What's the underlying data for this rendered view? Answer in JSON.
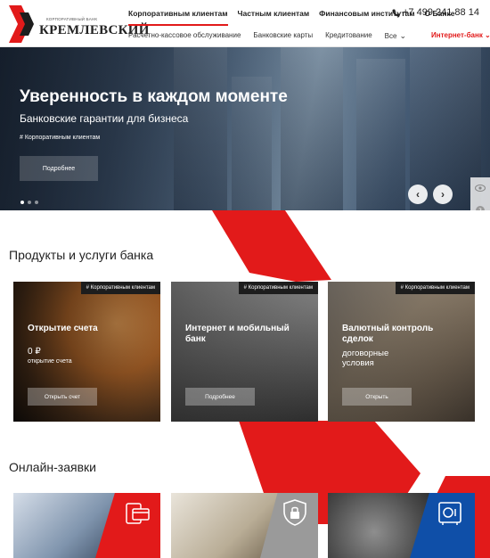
{
  "header": {
    "logo_small": "Корпоративный банк",
    "logo_name": "КРЕМЛЕВСКИЙ",
    "top_nav": [
      "Корпоративным клиентам",
      "Частным клиентам",
      "Финансовым институтам",
      "О Банке"
    ],
    "phone": "+7 499 241 88 14",
    "sub_nav": [
      "Расчетно-кассовое обслуживание",
      "Банковские карты",
      "Кредитование",
      "Все"
    ],
    "internet_bank": "Интернет-банк"
  },
  "hero": {
    "title": "Уверенность в каждом моменте",
    "subtitle": "Банковские гарантии для бизнеса",
    "tag": "# Корпоративным клиентам",
    "button": "Подробнее",
    "prev": "‹",
    "next": "›"
  },
  "products": {
    "title": "Продукты и услуги банка",
    "cards": [
      {
        "tag": "# Корпоративным клиентам",
        "title": "Открытие счета",
        "value": "0 ₽",
        "note": "открытие счета",
        "button": "Открыть счет"
      },
      {
        "tag": "# Корпоративным клиентам",
        "title": "Интернет и мобильный банк",
        "button": "Подробнее"
      },
      {
        "tag": "# Корпоративным клиентам",
        "title": "Валютный контроль сделок",
        "subtitle": "договорные условия",
        "button": "Открыть"
      }
    ]
  },
  "online": {
    "title": "Онлайн-заявки"
  },
  "colors": {
    "accent": "#e21a1a",
    "dark": "#1d1d1d"
  },
  "icons": [
    "phone-icon",
    "chevron-left-icon",
    "chevron-right-icon",
    "eye-icon",
    "help-icon",
    "location-icon",
    "card-icon",
    "shield-icon",
    "safe-icon"
  ]
}
